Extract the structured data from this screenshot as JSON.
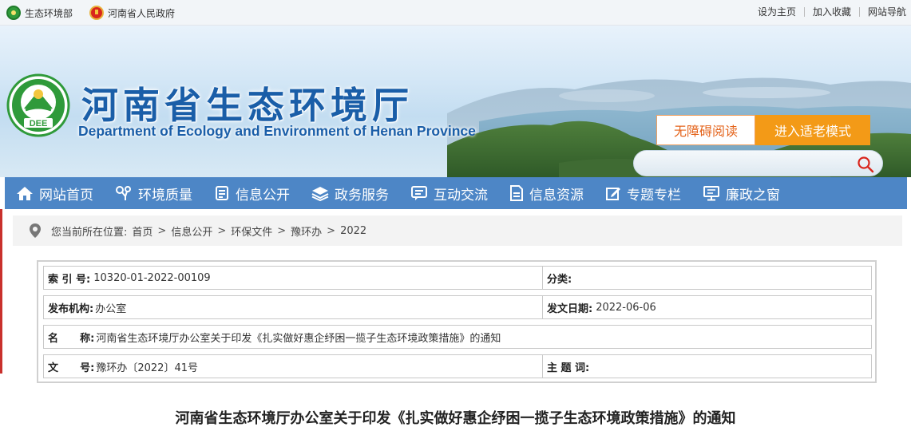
{
  "topbar": {
    "links_left": [
      "生态环境部",
      "河南省人民政府"
    ],
    "links_right": [
      "设为主页",
      "加入收藏",
      "网站导航"
    ]
  },
  "header": {
    "title": "河南省生态环境厅",
    "subtitle": "Department of Ecology and Environment of Henan Province",
    "logo_text": "DEE",
    "accessibility_button": "无障碍阅读",
    "elder_mode_button": "进入适老模式",
    "search": {
      "value": "",
      "placeholder": ""
    },
    "colors": {
      "brand_blue": "#1a5ea8",
      "accent_orange": "#f39a17",
      "nav_blue": "#4d86c6"
    }
  },
  "nav": {
    "items": [
      {
        "label": "网站首页",
        "icon": "home-icon"
      },
      {
        "label": "环境质量",
        "icon": "leaf-flower-icon"
      },
      {
        "label": "信息公开",
        "icon": "document-list-icon"
      },
      {
        "label": "政务服务",
        "icon": "layers-icon"
      },
      {
        "label": "互动交流",
        "icon": "chat-bubble-icon"
      },
      {
        "label": "信息资源",
        "icon": "file-icon"
      },
      {
        "label": "专题专栏",
        "icon": "edit-icon"
      },
      {
        "label": "廉政之窗",
        "icon": "monitor-icon"
      }
    ]
  },
  "breadcrumb": {
    "prefix": "您当前所在位置:",
    "items": [
      "首页",
      "信息公开",
      "环保文件",
      "豫环办",
      "2022"
    ]
  },
  "info": {
    "index_label": "索 引 号:",
    "index_value": "10320-01-2022-00109",
    "category_label": "分类:",
    "category_value": "",
    "issuer_label": "发布机构:",
    "issuer_value": "办公室",
    "date_label": "发文日期:",
    "date_value": "2022-06-06",
    "name_label": "名      称:",
    "name_value": "河南省生态环境厅办公室关于印发《扎实做好惠企纾困一揽子生态环境政策措施》的通知",
    "docno_label": "文      号:",
    "docno_value": "豫环办〔2022〕41号",
    "subject_label": "主 题 词:",
    "subject_value": ""
  },
  "article": {
    "title": "河南省生态环境厅办公室关于印发《扎实做好惠企纾困一揽子生态环境政策措施》的通知"
  }
}
